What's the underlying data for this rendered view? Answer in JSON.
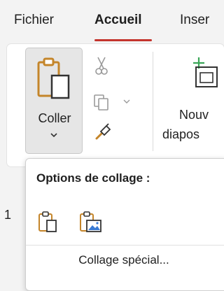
{
  "tabs": [
    {
      "label": "Fichier"
    },
    {
      "label": "Accueil",
      "active": true
    },
    {
      "label": "Inser"
    }
  ],
  "ribbon": {
    "paste_label": "Coller",
    "new_slide_label_line1": "Nouv",
    "new_slide_label_line2": "diapos"
  },
  "slide_number": "1",
  "paste_menu": {
    "title": "Options de collage :",
    "options": [
      {
        "icon": "keep-source-formatting-icon"
      },
      {
        "icon": "paste-picture-icon"
      }
    ],
    "special_prefix": "Colla",
    "special_underlined": "g",
    "special_suffix": "e spécial..."
  },
  "colors": {
    "accent_underline": "#c4342d",
    "paste_icon": "#c4852a",
    "new_slide_plus": "#3aa657"
  }
}
